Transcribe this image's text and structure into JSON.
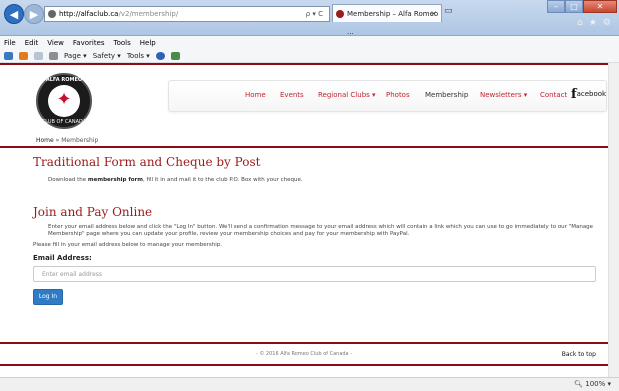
{
  "browser": {
    "address_host": "http://alfaclub.ca",
    "address_path": "/v2/membership/",
    "address_icons": "ρ ▾ C",
    "tab_title": "Membership – Alfa Romeo ...",
    "tab_close": "×",
    "menu": [
      "File",
      "Edit",
      "View",
      "Favorites",
      "Tools",
      "Help"
    ],
    "commands": [
      "Page ▾",
      "Safety ▾",
      "Tools ▾"
    ],
    "zoom": "100%"
  },
  "site": {
    "logo_top_text": "ALFA ROMEO",
    "logo_bottom_text": "CLUB OF CANADA",
    "nav": {
      "home": "Home",
      "events": "Events",
      "regional_clubs": "Regional Clubs",
      "photos": "Photos",
      "membership": "Membership",
      "newsletters": "Newsletters",
      "contact": "Contact",
      "facebook_f": "f",
      "facebook_rest": "acebook"
    },
    "breadcrumb": {
      "home": "Home",
      "sep": "»",
      "current": "Membership"
    },
    "section1": {
      "title": "Traditional Form and Cheque by Post",
      "text_before": "Download the ",
      "link": "membership form",
      "text_after": ", fill it in and mail it to the club P.O. Box with your cheque."
    },
    "section2": {
      "title": "Join and Pay Online",
      "text": "Enter your email address below and click the \"Log In\" button. We'll send a confirmation message to your email address which will contain a link which you can use to go immediately to our \"Manage Membership\" page where you can update your profile, review your membership choices and pay for your membership with PayPal.",
      "instructions": "Please fill in your email address below to manage your membership.",
      "email_label": "Email Address:",
      "email_placeholder": "Enter email address",
      "email_value": "",
      "login_button": "Log In"
    },
    "footer": {
      "copyright": "- © 2016 Alfa Romeo Club of Canada -",
      "back_to_top": "Back to top"
    }
  },
  "colors": {
    "brand_red": "#8b0d13",
    "link_red": "#c0242f",
    "heading_red": "#9b1b1b",
    "button_blue": "#2f7bc5"
  }
}
